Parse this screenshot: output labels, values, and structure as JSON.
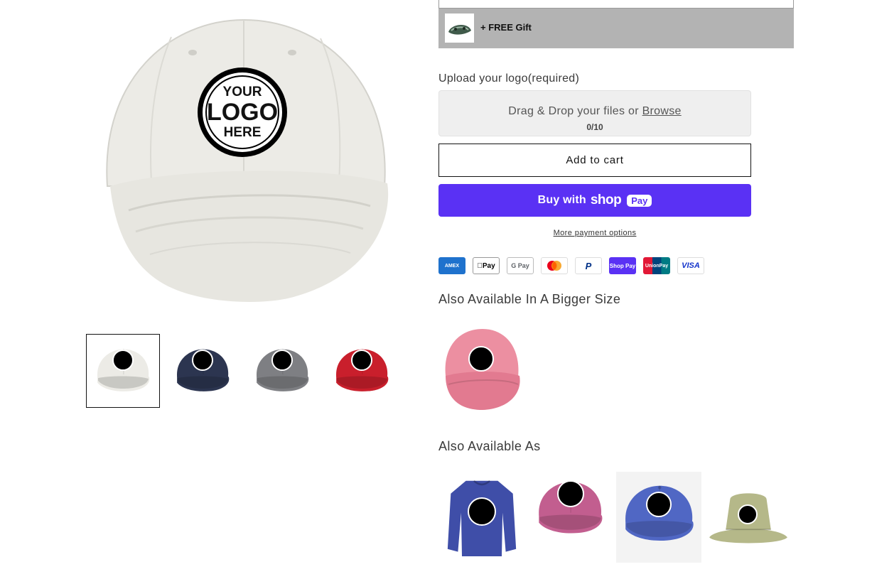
{
  "gift": {
    "label": "+ FREE Gift"
  },
  "upload": {
    "label": "Upload your logo(required)",
    "dropzone_text": "Drag & Drop your files or ",
    "browse_label": "Browse",
    "count": "0/10"
  },
  "cart": {
    "add_to_cart_label": "Add to cart",
    "buy_with_label": "Buy with",
    "shop_label": "shop",
    "pay_label": "Pay",
    "more_options_label": "More payment options"
  },
  "payment_methods": [
    {
      "name": "American Express",
      "label": "AMEX"
    },
    {
      "name": "Apple Pay",
      "label": "Pay"
    },
    {
      "name": "Google Pay",
      "label": "G Pay"
    },
    {
      "name": "Mastercard",
      "label": ""
    },
    {
      "name": "PayPal",
      "label": "P"
    },
    {
      "name": "Shop Pay",
      "label": "Shop Pay"
    },
    {
      "name": "UnionPay",
      "label": "UnionPay"
    },
    {
      "name": "Visa",
      "label": "VISA"
    }
  ],
  "logo_badge": {
    "line1": "YOUR",
    "line2": "LOGO",
    "line3": "HERE"
  },
  "gallery": {
    "thumbnails": [
      {
        "color": "#ecebe6"
      },
      {
        "color": "#2c3550"
      },
      {
        "color": "#7e7f83"
      },
      {
        "color": "#c91f2c"
      }
    ]
  },
  "bigger_size": {
    "title": "Also Available In A Bigger Size",
    "items": [
      {
        "product": "pink cap",
        "color": "#ec8fa1"
      }
    ]
  },
  "also_available": {
    "title": "Also Available As",
    "items": [
      {
        "product": "sweatshirt",
        "color": "#3f4ea8"
      },
      {
        "product": "washed cap",
        "color": "#c25e8f"
      },
      {
        "product": "denim cap",
        "color": "#5067c4"
      },
      {
        "product": "bucket hat",
        "color": "#b5b889"
      }
    ]
  }
}
